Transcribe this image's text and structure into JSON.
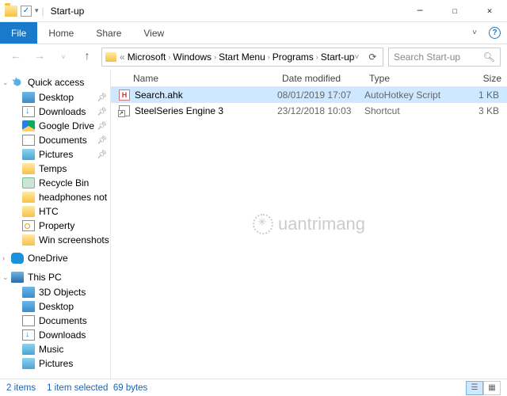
{
  "window": {
    "title": "Start-up"
  },
  "ribbon": {
    "file": "File",
    "tabs": [
      "Home",
      "Share",
      "View"
    ]
  },
  "nav": {
    "dd_small": "«"
  },
  "breadcrumb": {
    "items": [
      "Microsoft",
      "Windows",
      "Start Menu",
      "Programs",
      "Start-up"
    ]
  },
  "search": {
    "placeholder": "Search Start-up"
  },
  "sidebar": {
    "quick_access": "Quick access",
    "qa_items": [
      {
        "label": "Desktop",
        "icon": "desktop",
        "pinned": true
      },
      {
        "label": "Downloads",
        "icon": "dl",
        "pinned": true
      },
      {
        "label": "Google Drive",
        "icon": "gdrive",
        "pinned": true
      },
      {
        "label": "Documents",
        "icon": "doc",
        "pinned": true
      },
      {
        "label": "Pictures",
        "icon": "pic",
        "pinned": true
      },
      {
        "label": "Temps",
        "icon": "folder",
        "pinned": false
      },
      {
        "label": "Recycle Bin",
        "icon": "bin",
        "pinned": false
      },
      {
        "label": "headphones not",
        "icon": "hp",
        "pinned": false
      },
      {
        "label": "HTC",
        "icon": "folder",
        "pinned": false
      },
      {
        "label": "Property",
        "icon": "key",
        "pinned": false
      },
      {
        "label": "Win screenshots",
        "icon": "folder",
        "pinned": false
      }
    ],
    "onedrive": "OneDrive",
    "thispc": "This PC",
    "pc_items": [
      {
        "label": "3D Objects",
        "icon": "obj3d"
      },
      {
        "label": "Desktop",
        "icon": "desktop"
      },
      {
        "label": "Documents",
        "icon": "doc"
      },
      {
        "label": "Downloads",
        "icon": "dl"
      },
      {
        "label": "Music",
        "icon": "music"
      },
      {
        "label": "Pictures",
        "icon": "pic"
      }
    ]
  },
  "columns": {
    "name": "Name",
    "date": "Date modified",
    "type": "Type",
    "size": "Size"
  },
  "files": [
    {
      "name": "Search.ahk",
      "date": "08/01/2019 17:07",
      "type": "AutoHotkey Script",
      "size": "1 KB",
      "icon": "H",
      "selected": true
    },
    {
      "name": "SteelSeries Engine 3",
      "date": "23/12/2018 10:03",
      "type": "Shortcut",
      "size": "3 KB",
      "icon": "",
      "selected": false
    }
  ],
  "watermark": "uantrimang",
  "status": {
    "items": "2 items",
    "selected": "1 item selected",
    "size": "69 bytes"
  }
}
